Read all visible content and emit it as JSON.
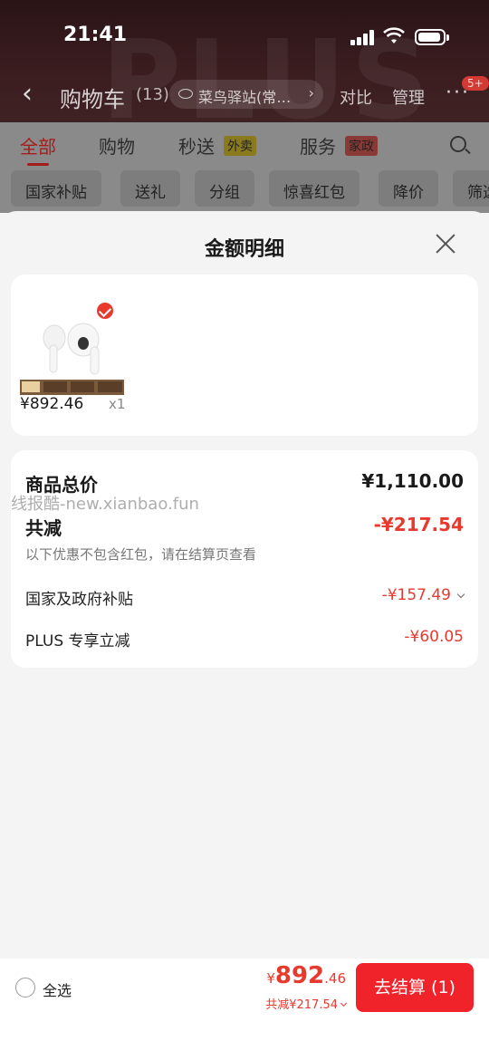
{
  "status": {
    "time": "21:41"
  },
  "nav": {
    "title": "购物车",
    "count": "(13)",
    "station": "菜鸟驿站(常…",
    "compare": "对比",
    "manage": "管理",
    "badge": "5+"
  },
  "tabs": [
    {
      "label": "全部"
    },
    {
      "label": "购物"
    },
    {
      "label": "秒送",
      "tag": "外卖"
    },
    {
      "label": "服务",
      "tag": "家政"
    }
  ],
  "chips": [
    "国家补贴",
    "送礼",
    "分组",
    "惊喜红包",
    "降价",
    "筛选"
  ],
  "sheet": {
    "title": "金额明细",
    "product": {
      "price": "¥892.46",
      "qty": "x1"
    },
    "summary": {
      "total_label": "商品总价",
      "total_value": "¥1,110.00",
      "reduce_label": "共减",
      "reduce_value": "-¥217.54",
      "note": "以下优惠不包含红包，请在结算页查看",
      "items": [
        {
          "label": "国家及政府补贴",
          "value": "-¥157.49"
        },
        {
          "label": "PLUS 专享立减",
          "value": "-¥60.05"
        }
      ]
    }
  },
  "watermark": "线报酷-new.xianbao.fun",
  "bottom": {
    "select_all": "全选",
    "currency": "¥",
    "total_int": "892",
    "total_dec": ".46",
    "saved": "共减¥217.54",
    "checkout": "去结算 (1)"
  },
  "colors": {
    "accent": "#f0222a",
    "price_red": "#e8392f"
  }
}
